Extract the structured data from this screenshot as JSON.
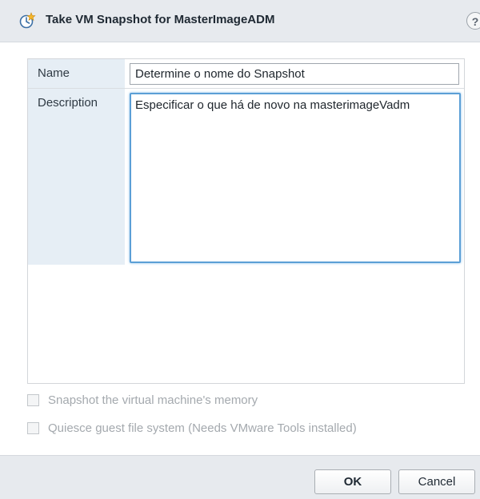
{
  "dialog": {
    "title": "Take VM Snapshot for MasterImageADM",
    "help_glyph": "?",
    "title_icon": "vm-snapshot-icon"
  },
  "form": {
    "name_label": "Name",
    "name_value": "Determine o nome do Snapshot",
    "description_label": "Description",
    "description_value": "Especificar o que há de novo na masterimageVadm"
  },
  "options": {
    "memory_label": "Snapshot the virtual machine's memory",
    "memory_checked": false,
    "quiesce_label": "Quiesce guest file system (Needs VMware Tools installed)",
    "quiesce_checked": false
  },
  "footer": {
    "ok_label": "OK",
    "cancel_label": "Cancel"
  }
}
